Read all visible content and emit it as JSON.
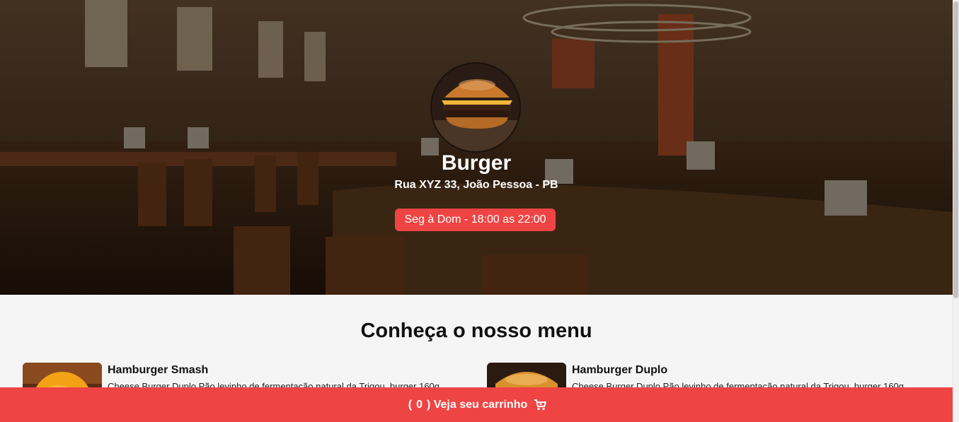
{
  "restaurant": {
    "name": "Burger",
    "address": "Rua XYZ 33, João Pessoa - PB",
    "hours": "Seg à Dom - 18:00 as 22:00"
  },
  "menu": {
    "title": "Conheça o nosso menu",
    "items": [
      {
        "name": "Hamburger Smash",
        "description": "Cheese Burger Duplo Pão levinho de fermentação natural da Trigou, burger 160g"
      },
      {
        "name": "Hamburger Duplo",
        "description": "Cheese Burger Duplo Pão levinho de fermentação natural da Trigou, burger 160g"
      }
    ]
  },
  "cart": {
    "open_paren": "(",
    "count": "0",
    "label": ") Veja seu carrinho",
    "icon": "cart-icon"
  },
  "colors": {
    "accent": "#ef4444",
    "background": "#f5f5f5"
  }
}
